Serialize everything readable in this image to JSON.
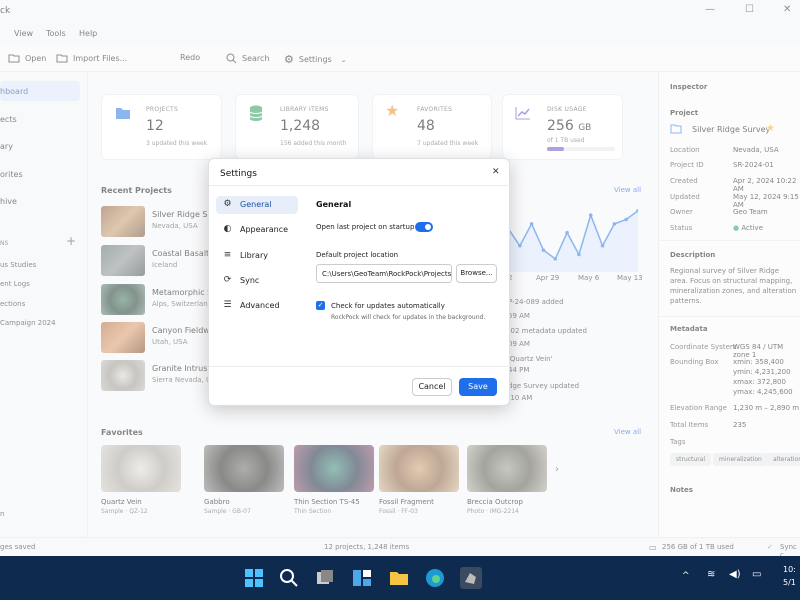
{
  "window": {
    "title": "ck",
    "controls": [
      "—",
      "☐",
      "✕"
    ]
  },
  "menu": [
    "View",
    "Tools",
    "Help"
  ],
  "toolbar": {
    "open": "Open",
    "import": "Import Files...",
    "redo": "Redo",
    "search": "Search",
    "settings": "Settings"
  },
  "sidebar": {
    "items": [
      "hboard",
      "ects",
      "ary",
      "orites",
      "hive"
    ],
    "section": "NS",
    "sub": [
      "us Studies",
      "ent Logs",
      "ections",
      "Campaign 2024"
    ],
    "bottom": "n"
  },
  "stats": [
    {
      "label": "PROJECTS",
      "value": "12",
      "sub": "3 updated this week",
      "icon": "folder-icon",
      "color": "#2f7de1"
    },
    {
      "label": "LIBRARY ITEMS",
      "value": "1,248",
      "sub": "156 added this month",
      "icon": "database-icon",
      "color": "#2e9d5b"
    },
    {
      "label": "FAVORITES",
      "value": "48",
      "sub": "7 updated this week",
      "icon": "star-icon",
      "color": "#f0902a"
    },
    {
      "label": "DISK USAGE",
      "value": "256",
      "unit": "GB",
      "sub": "of 1 TB used",
      "icon": "chart-icon",
      "color": "#6d4fc7",
      "fill": 0.25
    }
  ],
  "recent": {
    "title": "Recent Projects",
    "view_all": "View all",
    "items": [
      {
        "name": "Silver Ridge Surv",
        "loc": "Nevada, USA"
      },
      {
        "name": "Coastal Basalt St",
        "loc": "Iceland"
      },
      {
        "name": "Metamorphic Se",
        "loc": "Alps, Switzerland"
      },
      {
        "name": "Canyon Fieldwor",
        "loc": "Utah, USA"
      },
      {
        "name": "Granite Intrusion",
        "loc": "Sierra Nevada, USA"
      }
    ]
  },
  "activity": {
    "view_all": "View all",
    "dates": [
      "2",
      "Apr 29",
      "May 6",
      "May 13"
    ],
    "values": [
      10,
      6,
      11,
      5,
      3,
      9,
      4,
      13,
      6,
      11,
      12,
      14
    ],
    "items": [
      "P-24-089 added",
      "-02 metadata updated",
      "'Quartz Vein'",
      "44 PM",
      "dge Survey updated",
      ":10 AM",
      "09 AM",
      "59 AM"
    ]
  },
  "favorites": {
    "title": "Favorites",
    "view_all": "View all",
    "items": [
      {
        "name": "Quartz Vein",
        "sub": "Sample · QZ-12"
      },
      {
        "name": "Gabbro",
        "sub": "Sample · GB-07"
      },
      {
        "name": "Thin Section TS-45",
        "sub": "Thin Section"
      },
      {
        "name": "Fossil Fragment",
        "sub": "Fossil · FF-03"
      },
      {
        "name": "Breccia Outcrop",
        "sub": "Photo · IMG-2214"
      }
    ]
  },
  "inspector": {
    "title": "Inspector",
    "project_h": "Project",
    "project_name": "Silver Ridge Survey",
    "fields": [
      [
        "Location",
        "Nevada, USA"
      ],
      [
        "Project ID",
        "SR-2024-01"
      ],
      [
        "Created",
        "Apr 2, 2024 10:22 AM"
      ],
      [
        "Updated",
        "May 12, 2024 9:15 AM"
      ],
      [
        "Owner",
        "Geo Team"
      ],
      [
        "Status",
        "Active"
      ]
    ],
    "desc_h": "Description",
    "desc": "Regional survey of Silver Ridge area. Focus on structural mapping, mineralization zones, and alteration patterns.",
    "meta_h": "Metadata",
    "cs_k": "Coordinate System",
    "cs_v": "WGS 84 / UTM zone 1",
    "bb_k": "Bounding Box",
    "bb": [
      "xmin: 358,400",
      "ymin: 4,231,200",
      "xmax: 372,800",
      "ymax: 4,245,600"
    ],
    "el_k": "Elevation Range",
    "el_v": "1,230 m – 2,890 m",
    "ti_k": "Total Items",
    "ti_v": "235",
    "tags_h": "Tags",
    "tags": [
      "structural",
      "mineralization",
      "alteration"
    ],
    "notes_h": "Notes"
  },
  "status": {
    "left": "ges saved",
    "center": "12 projects, 1,248 items",
    "disk": "256 GB of 1 TB used",
    "sync": "Sync c"
  },
  "taskbar": {
    "time": "10:",
    "date": "5/1"
  },
  "dialog": {
    "title": "Settings",
    "close": "✕",
    "nav": [
      {
        "label": "General",
        "icon": "⚙"
      },
      {
        "label": "Appearance",
        "icon": "◐"
      },
      {
        "label": "Library",
        "icon": "≡"
      },
      {
        "label": "Sync",
        "icon": "⟳"
      },
      {
        "label": "Advanced",
        "icon": "☰"
      }
    ],
    "section": "General",
    "open_last": "Open last project on startup",
    "open_last_on": true,
    "default_loc": "Default project location",
    "path": "C:\\Users\\GeoTeam\\RockPock\\Projects",
    "browse": "Browse...",
    "check_updates": "Check for updates automatically",
    "check_updates_on": true,
    "check_note": "RockPock will check for updates in the background.",
    "cancel": "Cancel",
    "save": "Save"
  }
}
